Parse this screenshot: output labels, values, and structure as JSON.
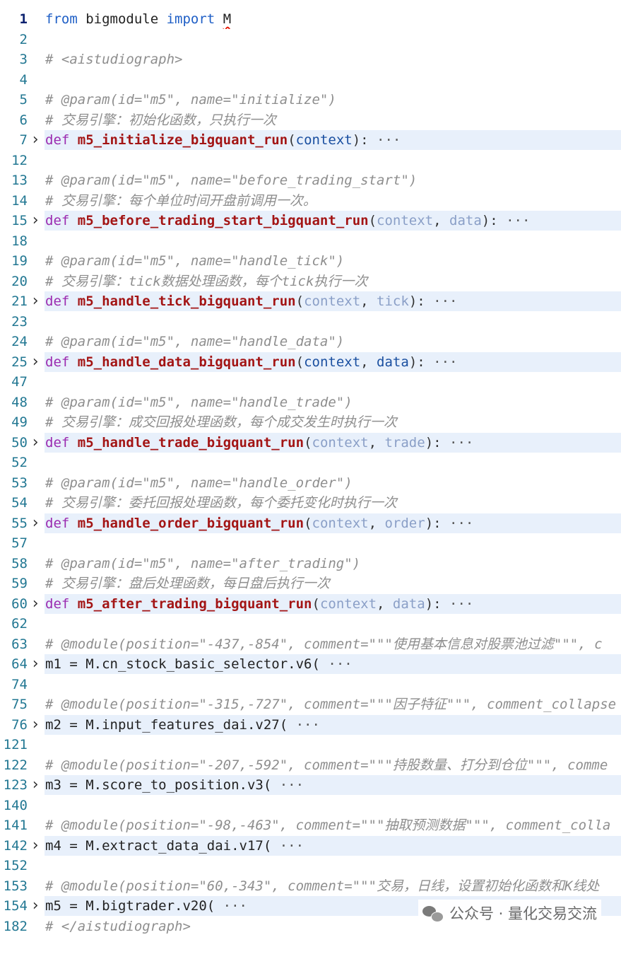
{
  "editor": {
    "lines": [
      {
        "no": "1",
        "fold": false,
        "tokens": [
          [
            "kw",
            "from"
          ],
          [
            "ident",
            " bigmodule "
          ],
          [
            "kw",
            "import"
          ],
          [
            "ident",
            " "
          ],
          [
            "ident-sq",
            "M"
          ]
        ]
      },
      {
        "no": "2",
        "fold": false,
        "tokens": []
      },
      {
        "no": "3",
        "fold": false,
        "tokens": [
          [
            "comment",
            "# <aistudiograph>"
          ]
        ]
      },
      {
        "no": "4",
        "fold": false,
        "tokens": []
      },
      {
        "no": "5",
        "fold": false,
        "tokens": [
          [
            "comment",
            "# @param(id=\"m5\", name=\"initialize\")"
          ]
        ]
      },
      {
        "no": "6",
        "fold": false,
        "tokens": [
          [
            "comment",
            "# 交易引擎：初始化函数，只执行一次"
          ]
        ]
      },
      {
        "no": "7",
        "fold": true,
        "tokens": [
          [
            "def",
            "def "
          ],
          [
            "fn",
            "m5_initialize_bigquant_run"
          ],
          [
            "punc",
            "("
          ],
          [
            "param",
            "context"
          ],
          [
            "punc",
            "):"
          ],
          [
            "ellipsis",
            " ···"
          ]
        ]
      },
      {
        "no": "12",
        "fold": false,
        "tokens": []
      },
      {
        "no": "13",
        "fold": false,
        "tokens": [
          [
            "comment",
            "# @param(id=\"m5\", name=\"before_trading_start\")"
          ]
        ]
      },
      {
        "no": "14",
        "fold": false,
        "tokens": [
          [
            "comment",
            "# 交易引擎：每个单位时间开盘前调用一次。"
          ]
        ]
      },
      {
        "no": "15",
        "fold": true,
        "tokens": [
          [
            "def",
            "def "
          ],
          [
            "fn",
            "m5_before_trading_start_bigquant_run"
          ],
          [
            "punc",
            "("
          ],
          [
            "param-dim",
            "context"
          ],
          [
            "punc",
            ", "
          ],
          [
            "param-dim",
            "data"
          ],
          [
            "punc",
            "):"
          ],
          [
            "ellipsis",
            " ···"
          ]
        ]
      },
      {
        "no": "18",
        "fold": false,
        "tokens": []
      },
      {
        "no": "19",
        "fold": false,
        "tokens": [
          [
            "comment",
            "# @param(id=\"m5\", name=\"handle_tick\")"
          ]
        ]
      },
      {
        "no": "20",
        "fold": false,
        "tokens": [
          [
            "comment",
            "# 交易引擎：tick数据处理函数，每个tick执行一次"
          ]
        ]
      },
      {
        "no": "21",
        "fold": true,
        "tokens": [
          [
            "def",
            "def "
          ],
          [
            "fn",
            "m5_handle_tick_bigquant_run"
          ],
          [
            "punc",
            "("
          ],
          [
            "param-dim",
            "context"
          ],
          [
            "punc",
            ", "
          ],
          [
            "param-dim",
            "tick"
          ],
          [
            "punc",
            "):"
          ],
          [
            "ellipsis",
            " ···"
          ]
        ]
      },
      {
        "no": "23",
        "fold": false,
        "tokens": []
      },
      {
        "no": "24",
        "fold": false,
        "tokens": [
          [
            "comment",
            "# @param(id=\"m5\", name=\"handle_data\")"
          ]
        ]
      },
      {
        "no": "25",
        "fold": true,
        "tokens": [
          [
            "def",
            "def "
          ],
          [
            "fn",
            "m5_handle_data_bigquant_run"
          ],
          [
            "punc",
            "("
          ],
          [
            "param",
            "context"
          ],
          [
            "punc",
            ", "
          ],
          [
            "param",
            "data"
          ],
          [
            "punc",
            "):"
          ],
          [
            "ellipsis",
            " ···"
          ]
        ]
      },
      {
        "no": "47",
        "fold": false,
        "tokens": []
      },
      {
        "no": "48",
        "fold": false,
        "tokens": [
          [
            "comment",
            "# @param(id=\"m5\", name=\"handle_trade\")"
          ]
        ]
      },
      {
        "no": "49",
        "fold": false,
        "tokens": [
          [
            "comment",
            "# 交易引擎：成交回报处理函数，每个成交发生时执行一次"
          ]
        ]
      },
      {
        "no": "50",
        "fold": true,
        "tokens": [
          [
            "def",
            "def "
          ],
          [
            "fn",
            "m5_handle_trade_bigquant_run"
          ],
          [
            "punc",
            "("
          ],
          [
            "param-dim",
            "context"
          ],
          [
            "punc",
            ", "
          ],
          [
            "param-dim",
            "trade"
          ],
          [
            "punc",
            "):"
          ],
          [
            "ellipsis",
            " ···"
          ]
        ]
      },
      {
        "no": "52",
        "fold": false,
        "tokens": []
      },
      {
        "no": "53",
        "fold": false,
        "tokens": [
          [
            "comment",
            "# @param(id=\"m5\", name=\"handle_order\")"
          ]
        ]
      },
      {
        "no": "54",
        "fold": false,
        "tokens": [
          [
            "comment",
            "# 交易引擎：委托回报处理函数，每个委托变化时执行一次"
          ]
        ]
      },
      {
        "no": "55",
        "fold": true,
        "tokens": [
          [
            "def",
            "def "
          ],
          [
            "fn",
            "m5_handle_order_bigquant_run"
          ],
          [
            "punc",
            "("
          ],
          [
            "param-dim",
            "context"
          ],
          [
            "punc",
            ", "
          ],
          [
            "param-dim",
            "order"
          ],
          [
            "punc",
            "):"
          ],
          [
            "ellipsis",
            " ···"
          ]
        ]
      },
      {
        "no": "57",
        "fold": false,
        "tokens": []
      },
      {
        "no": "58",
        "fold": false,
        "tokens": [
          [
            "comment",
            "# @param(id=\"m5\", name=\"after_trading\")"
          ]
        ]
      },
      {
        "no": "59",
        "fold": false,
        "tokens": [
          [
            "comment",
            "# 交易引擎：盘后处理函数，每日盘后执行一次"
          ]
        ]
      },
      {
        "no": "60",
        "fold": true,
        "tokens": [
          [
            "def",
            "def "
          ],
          [
            "fn",
            "m5_after_trading_bigquant_run"
          ],
          [
            "punc",
            "("
          ],
          [
            "param-dim",
            "context"
          ],
          [
            "punc",
            ", "
          ],
          [
            "param-dim",
            "data"
          ],
          [
            "punc",
            "):"
          ],
          [
            "ellipsis",
            " ···"
          ]
        ]
      },
      {
        "no": "62",
        "fold": false,
        "tokens": []
      },
      {
        "no": "63",
        "fold": false,
        "tokens": [
          [
            "comment",
            "# @module(position=\"-437,-854\", comment=\"\"\"使用基本信息对股票池过滤\"\"\", c"
          ]
        ]
      },
      {
        "no": "64",
        "fold": true,
        "tokens": [
          [
            "ident",
            "m1 = M.cn_stock_basic_selector.v6("
          ],
          [
            "ellipsis",
            " ···"
          ]
        ]
      },
      {
        "no": "74",
        "fold": false,
        "tokens": []
      },
      {
        "no": "75",
        "fold": false,
        "tokens": [
          [
            "comment",
            "# @module(position=\"-315,-727\", comment=\"\"\"因子特征\"\"\", comment_collapse"
          ]
        ]
      },
      {
        "no": "76",
        "fold": true,
        "tokens": [
          [
            "ident",
            "m2 = M.input_features_dai.v27("
          ],
          [
            "ellipsis",
            " ···"
          ]
        ]
      },
      {
        "no": "121",
        "fold": false,
        "tokens": []
      },
      {
        "no": "122",
        "fold": false,
        "tokens": [
          [
            "comment",
            "# @module(position=\"-207,-592\", comment=\"\"\"持股数量、打分到仓位\"\"\", comme"
          ]
        ]
      },
      {
        "no": "123",
        "fold": true,
        "tokens": [
          [
            "ident",
            "m3 = M.score_to_position.v3("
          ],
          [
            "ellipsis",
            " ···"
          ]
        ]
      },
      {
        "no": "140",
        "fold": false,
        "tokens": []
      },
      {
        "no": "141",
        "fold": false,
        "tokens": [
          [
            "comment",
            "# @module(position=\"-98,-463\", comment=\"\"\"抽取预测数据\"\"\", comment_colla"
          ]
        ]
      },
      {
        "no": "142",
        "fold": true,
        "tokens": [
          [
            "ident",
            "m4 = M.extract_data_dai.v17("
          ],
          [
            "ellipsis",
            " ···"
          ]
        ]
      },
      {
        "no": "152",
        "fold": false,
        "tokens": []
      },
      {
        "no": "153",
        "fold": false,
        "tokens": [
          [
            "comment",
            "# @module(position=\"60,-343\", comment=\"\"\"交易，日线，设置初始化函数和K线处"
          ]
        ]
      },
      {
        "no": "154",
        "fold": true,
        "tokens": [
          [
            "ident",
            "m5 = M.bigtrader.v20("
          ],
          [
            "ellipsis",
            " ···"
          ]
        ]
      },
      {
        "no": "182",
        "fold": false,
        "tokens": [
          [
            "comment",
            "# </aistudiograph>"
          ]
        ]
      }
    ]
  },
  "watermark": {
    "icon": "wechat-icon",
    "text": "公众号 · 量化交易交流"
  },
  "colors": {
    "folded_line_bg": "#e8f0fb",
    "line_number": "#237893",
    "keyword": "#1f5fc6",
    "function_name": "#a31515",
    "comment": "#8e8e8e"
  }
}
